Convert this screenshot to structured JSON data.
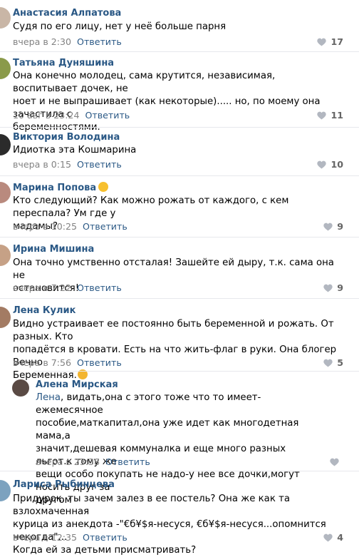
{
  "ui": {
    "reply_label": "Ответить"
  },
  "comments": [
    {
      "author": "Анастасия Алпатова",
      "text": "Судя по его лицу, нет у неё больше парня",
      "time": "вчера в 2:30",
      "likes": "17"
    },
    {
      "author": "Татьяна Дуняшина",
      "text": "Она конечно молодец, сама крутится, независимая, воспитывает дочек, не\nноет и не выпрашивает (как некоторые)..... но, по моему она зачастила с\nбеременностями.",
      "time": "10 авг в 23:24",
      "likes": "11"
    },
    {
      "author": "Виктория Володина",
      "text": "Идиотка эта Кошмарина",
      "time": "вчера в 0:15",
      "likes": "10"
    },
    {
      "author": "Марина Попова",
      "text": "Кто следующий? Как можно рожать от каждого, с кем переспала? Ум где у\nмадамы?",
      "time": "вчера в 10:25",
      "likes": "9"
    },
    {
      "author": "Ирина Мишина",
      "text": "Она точно умственно отсталая! Зашейте ей дыру, т.к. сама она не\nостановится!",
      "time": "вчера в 7:22",
      "likes": "9"
    },
    {
      "author": "Лена Кулик",
      "text": "Видно устраивает ее постоянно быть беременной и рожать. От разных. Кто\nпопадётся в кровати. Есть на что жить-флаг в руки. Она блогер Вечно\nБеременная.",
      "time": "вчера в 7:56",
      "likes": "5"
    },
    {
      "author": "Алена Мирская",
      "mention": "Лена",
      "text": ", видать,она с этого тоже что то имеет-ежемесячное\nпособие,маткапитал,она уже идет как многодетная мама,а\nзначит,дешевая коммуналка и еще много разных льгот.к тому же\nвещи особо покупать не надо-у нее все дочки,могут носить друг за\nдругом",
      "time": "вчера в 23:38",
      "likes": ""
    },
    {
      "author": "Лариса Рыбинцева",
      "text": "Придурок, ты зачем залез в ее постель? Она же как та взлохмаченная\nкурица из анекдота -\"€б¥$я-несуся, €б¥$я-несуся...опомнится некогда\"...\nКогда ей за детьми присматривать?",
      "time": "вчера в 12:35",
      "likes": "4"
    }
  ]
}
